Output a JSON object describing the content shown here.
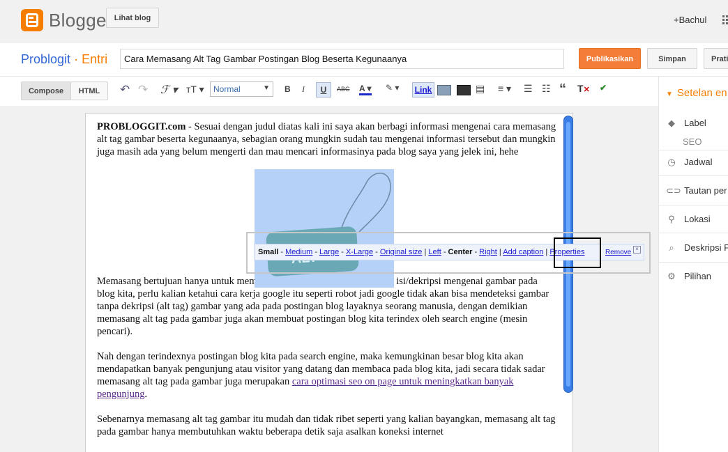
{
  "header": {
    "app_name": "Blogger",
    "view_blog_label": "Lihat blog",
    "user": "+Bachul"
  },
  "post": {
    "blog_name": "Problogit",
    "separator": "·",
    "section": "Entri",
    "title": "Cara Memasang Alt Tag Gambar Postingan Blog Beserta Kegunaanya",
    "publish_label": "Publikasikan",
    "save_label": "Simpan",
    "preview_label": "Prati"
  },
  "toolbar": {
    "compose_label": "Compose",
    "html_label": "HTML",
    "format_value": "Normal",
    "link_label": "Link"
  },
  "settings": {
    "header": "Setelan en",
    "items": [
      {
        "label": "Label",
        "icon": "tag-icon"
      },
      {
        "label": "SEO",
        "icon": ""
      },
      {
        "label": "Jadwal",
        "icon": "clock-icon"
      },
      {
        "label": "Tautan per",
        "icon": "link-icon"
      },
      {
        "label": "Lokasi",
        "icon": "pin-icon"
      },
      {
        "label": "Deskripsi P",
        "icon": "search-icon"
      },
      {
        "label": "Pilihan",
        "icon": "gear-icon"
      }
    ]
  },
  "content": {
    "p1_bold": "PROBLOGGIT.com",
    "p1_text": " - Sesuai dengan judul diatas kali ini saya akan berbagi informasi mengenai cara memasang alt tag gambar beserta kegunaanya, sebagian orang mungkin sudah tau mengenai informasi tersebut dan mungkin juga masih ada yang belum mengerti dan mau mencari informasinya pada blog saya yang jelek ini, hehe",
    "image_text": "ALT",
    "p2": "Memasang bertujuan hanya untuk memudakan search engine mengetahui isi/dekripsi mengenai gambar pada blog kita, perlu kalian ketahui cara kerja google itu seperti robot jadi google tidak akan bisa mendeteksi gambar tanpa dekripsi (alt tag) gambar yang ada pada postingan blog layaknya seorang manusia, dengan demikian memasang alt tag pada gambar juga akan membuat postingan blog kita terindex oleh search engine (mesin pencari).",
    "p3_text": "Nah dengan terindexnya postingan blog kita pada search engine, maka kemungkinan besar blog kita akan mendapatkan banyak pengunjung atau visitor yang datang dan membaca pada blog kita, jadi secara tidak sadar memasang alt tag pada gambar juga merupakan ",
    "p3_link": "cara optimasi seo on page untuk meningkatkan banyak pengunjung",
    "p3_end": ".",
    "p4": "Sebenarnya memasang alt tag gambar itu mudah dan tidak ribet seperti yang kalian bayangkan, memasang alt tag pada gambar hanya membutuhkan waktu beberapa detik saja asalkan koneksi internet"
  },
  "image_bar": {
    "small": "Small",
    "dash": " - ",
    "medium": "Medium",
    "large": "Large",
    "xlarge": "X-Large",
    "original": "Original size",
    "pipe": " | ",
    "left": "Left",
    "center": "Center",
    "right": "Right",
    "caption": "Add caption",
    "properties": "Properties",
    "remove": "Remove",
    "close": "×"
  },
  "colors": {
    "accent": "#f57d00",
    "link_blue": "#3367d6",
    "selection": "#b5d1f7"
  }
}
